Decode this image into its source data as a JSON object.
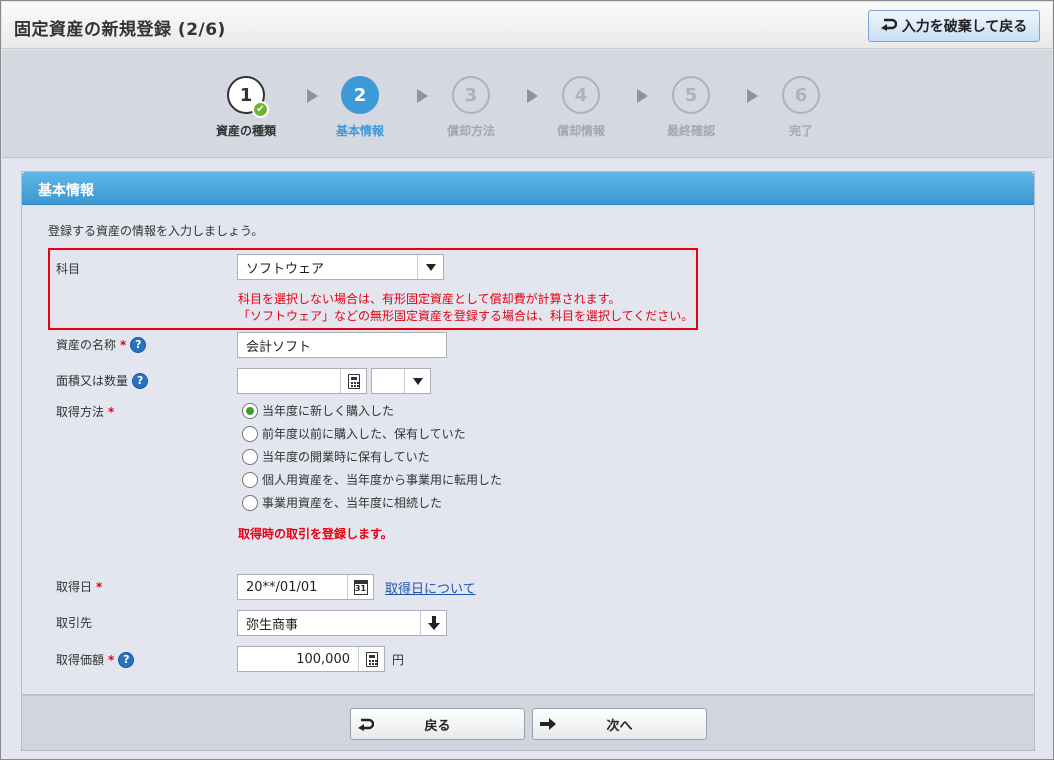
{
  "header": {
    "title": "固定資産の新規登録 (2/6)",
    "discard_label": "入力を破棄して戻る"
  },
  "steps": [
    {
      "num": "1",
      "label": "資産の種類",
      "state": "done"
    },
    {
      "num": "2",
      "label": "基本情報",
      "state": "active"
    },
    {
      "num": "3",
      "label": "償却方法",
      "state": "future"
    },
    {
      "num": "4",
      "label": "償却情報",
      "state": "future"
    },
    {
      "num": "5",
      "label": "最終確認",
      "state": "future"
    },
    {
      "num": "6",
      "label": "完了",
      "state": "future"
    }
  ],
  "panel": {
    "title": "基本情報",
    "intro": "登録する資産の情報を入力しましょう。"
  },
  "form": {
    "account": {
      "label": "科目",
      "value": "ソフトウェア",
      "error1": "科目を選択しない場合は、有形固定資産として償却費が計算されます。",
      "error2": "「ソフトウェア」などの無形固定資産を登録する場合は、科目を選択してください。"
    },
    "asset_name": {
      "label": "資産の名称",
      "required": "*",
      "value": "会計ソフト"
    },
    "quantity": {
      "label": "面積又は数量",
      "value": "",
      "unit": ""
    },
    "method": {
      "label": "取得方法",
      "required": "*",
      "options": [
        "当年度に新しく購入した",
        "前年度以前に購入した、保有していた",
        "当年度の開業時に保有していた",
        "個人用資産を、当年度から事業用に転用した",
        "事業用資産を、当年度に相続した"
      ],
      "selected_index": 0,
      "note": "取得時の取引を登録します。"
    },
    "acq_date": {
      "label": "取得日",
      "required": "*",
      "value": "20**/01/01",
      "link": "取得日について",
      "cal_day": "31"
    },
    "partner": {
      "label": "取引先",
      "value": "弥生商事"
    },
    "price": {
      "label": "取得価額",
      "required": "*",
      "value": "100,000",
      "unit": "円"
    }
  },
  "footer": {
    "back_label": "戻る",
    "next_label": "次へ"
  },
  "colors": {
    "accent": "#3e9ad6",
    "error": "#e60012",
    "check": "#6fb52c"
  }
}
